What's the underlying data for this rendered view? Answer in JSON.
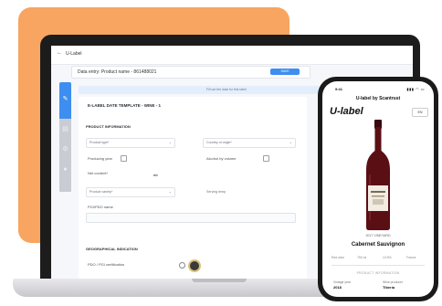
{
  "laptop": {
    "back_label": "U-Label",
    "product_bar": "Data entry: Product name - 861488021",
    "save_label": "SAVE",
    "banner": "Fill out the data for this label",
    "template_title": "E-LABEL DATE TEMPLATE - WINE - 1",
    "section_product": "PRODUCT INFORMATION",
    "fields": {
      "product_type": "Product type*",
      "country_origin": "Country of origin*",
      "producing_year": "Producing year",
      "alcohol_content": "Alcohol by volume",
      "net_content": "Net content*",
      "product_variety": "Product variety*",
      "serving_temp": "Serving temp",
      "pgi_name": "PGI/PDO name"
    },
    "unit_ml": "ml",
    "section_geo": "GEOGRAPHICAL INDICATION",
    "geo_field": "PDO / PGI certification"
  },
  "phone": {
    "time": "9:41",
    "status": "▮▮▮ ◠ ▭",
    "title": "U-label by Scantrust",
    "logo": "U-label",
    "lang": "EN",
    "vintage": "2017 VINEYARD",
    "wine_name": "Cabernet Sauvignon",
    "meta": [
      "Red wine",
      "750 ml",
      "13.5%",
      "France"
    ],
    "product_info": "PRODUCT INFORMATION",
    "cells": [
      {
        "label": "Vintage year",
        "value": "2018"
      },
      {
        "label": "Wine producer",
        "value": "Tiberia"
      }
    ]
  },
  "colors": {
    "accent": "#3d8ef0",
    "orange": "#f7a560",
    "wine": "#5a0f15"
  }
}
